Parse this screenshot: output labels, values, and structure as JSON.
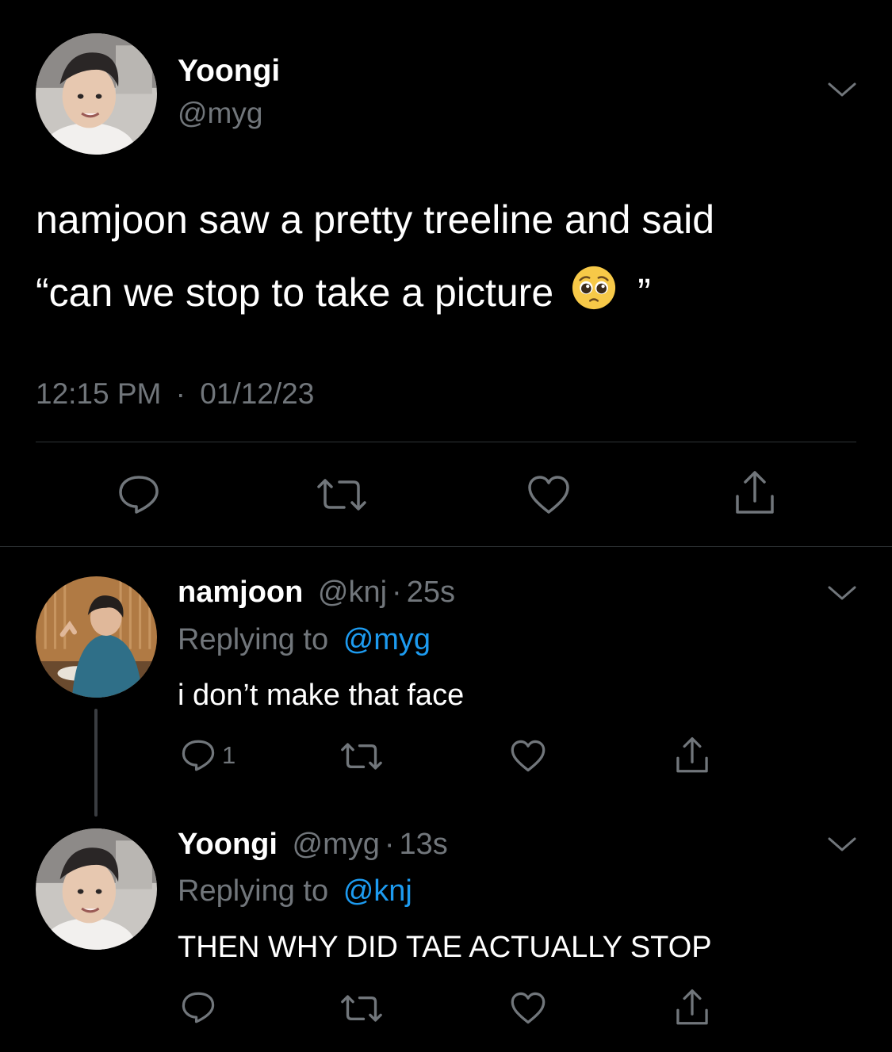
{
  "main_tweet": {
    "display_name": "Yoongi",
    "handle": "@myg",
    "text_line1": "namjoon saw a pretty treeline and said",
    "text_line2_before_emoji": "“can we stop to take a picture",
    "emoji_icon": "pleading-face-icon",
    "text_line2_after_emoji": "”",
    "time": "12:15 PM",
    "separator": "·",
    "date": "01/12/23"
  },
  "reply1": {
    "display_name": "namjoon",
    "handle": "@knj",
    "separator": "·",
    "time_ago": "25s",
    "replying_to_label": "Replying to",
    "replying_to_handle": "@myg",
    "text": "i don’t make that face",
    "reply_count": "1"
  },
  "reply2": {
    "display_name": "Yoongi",
    "handle": "@myg",
    "separator": "·",
    "time_ago": "13s",
    "replying_to_label": "Replying to",
    "replying_to_handle": "@knj",
    "text": "THEN WHY DID TAE ACTUALLY STOP"
  },
  "icons": {
    "reply": "reply-icon",
    "retweet": "retweet-icon",
    "like": "heart-icon",
    "share": "share-icon",
    "more": "chevron-down-icon"
  },
  "colors": {
    "background": "#000000",
    "text": "#ffffff",
    "muted": "#71767b",
    "link": "#1d9bf0",
    "divider": "#2f3336"
  }
}
